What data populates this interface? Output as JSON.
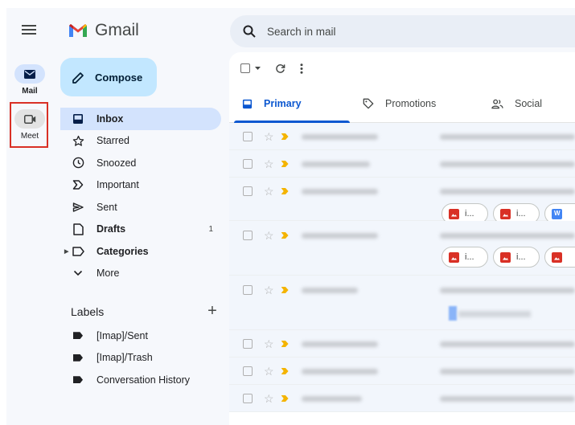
{
  "rail": {
    "mail_label": "Mail",
    "meet_label": "Meet"
  },
  "brand": {
    "name": "Gmail"
  },
  "compose": {
    "label": "Compose"
  },
  "nav": {
    "items": [
      {
        "label": "Inbox",
        "icon": "inbox-icon",
        "active": true,
        "bold": true,
        "count": ""
      },
      {
        "label": "Starred",
        "icon": "star-icon",
        "active": false,
        "bold": false,
        "count": ""
      },
      {
        "label": "Snoozed",
        "icon": "clock-icon",
        "active": false,
        "bold": false,
        "count": ""
      },
      {
        "label": "Important",
        "icon": "important-icon",
        "active": false,
        "bold": false,
        "count": ""
      },
      {
        "label": "Sent",
        "icon": "send-icon",
        "active": false,
        "bold": false,
        "count": ""
      },
      {
        "label": "Drafts",
        "icon": "draft-icon",
        "active": false,
        "bold": true,
        "count": "1"
      },
      {
        "label": "Categories",
        "icon": "label-outline-icon",
        "active": false,
        "bold": true,
        "count": ""
      },
      {
        "label": "More",
        "icon": "chevron-down-icon",
        "active": false,
        "bold": false,
        "count": ""
      }
    ]
  },
  "labels": {
    "heading": "Labels",
    "add_symbol": "+",
    "items": [
      {
        "label": "[Imap]/Sent"
      },
      {
        "label": "[Imap]/Trash"
      },
      {
        "label": "Conversation History"
      }
    ]
  },
  "search": {
    "placeholder": "Search in mail"
  },
  "tabs": [
    {
      "label": "Primary",
      "icon": "inbox-icon",
      "active": true
    },
    {
      "label": "Promotions",
      "icon": "tag-icon",
      "active": false
    },
    {
      "label": "Social",
      "icon": "people-icon",
      "active": false
    }
  ],
  "attachment_chip_text": "i...",
  "word_chip_letter": "W",
  "colors": {
    "accent": "#0b57d0",
    "compose_bg": "#c2e7ff",
    "active_nav_bg": "#d3e3fd",
    "highlight": "#d93025",
    "important_marker": "#f4b400"
  }
}
